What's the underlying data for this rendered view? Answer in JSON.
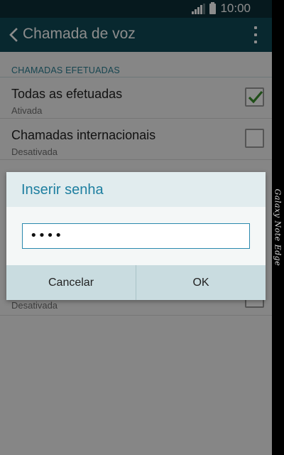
{
  "status_bar": {
    "time": "10:00",
    "signal_icon": "signal-icon",
    "battery_icon": "battery-icon"
  },
  "action_bar": {
    "title": "Chamada de voz",
    "back_icon": "chevron-left-icon",
    "menu_icon": "more-vertical-icon"
  },
  "settings": {
    "section_header": "CHAMADAS EFETUADAS",
    "items": [
      {
        "title": "Todas as efetuadas",
        "status": "Ativada",
        "checked": true
      },
      {
        "title": "Chamadas internacionais",
        "status": "Desativada",
        "checked": false
      },
      {
        "title": "",
        "status": "Desativada",
        "checked": false
      }
    ]
  },
  "dialog": {
    "title": "Inserir senha",
    "password_value": "••••",
    "cancel_label": "Cancelar",
    "ok_label": "OK"
  },
  "edge_label": "Galaxy Note Edge",
  "colors": {
    "status_bar": "#0b2e37",
    "action_bar": "#0f4a57",
    "accent": "#2a7f93",
    "check": "#3b8f2d"
  }
}
